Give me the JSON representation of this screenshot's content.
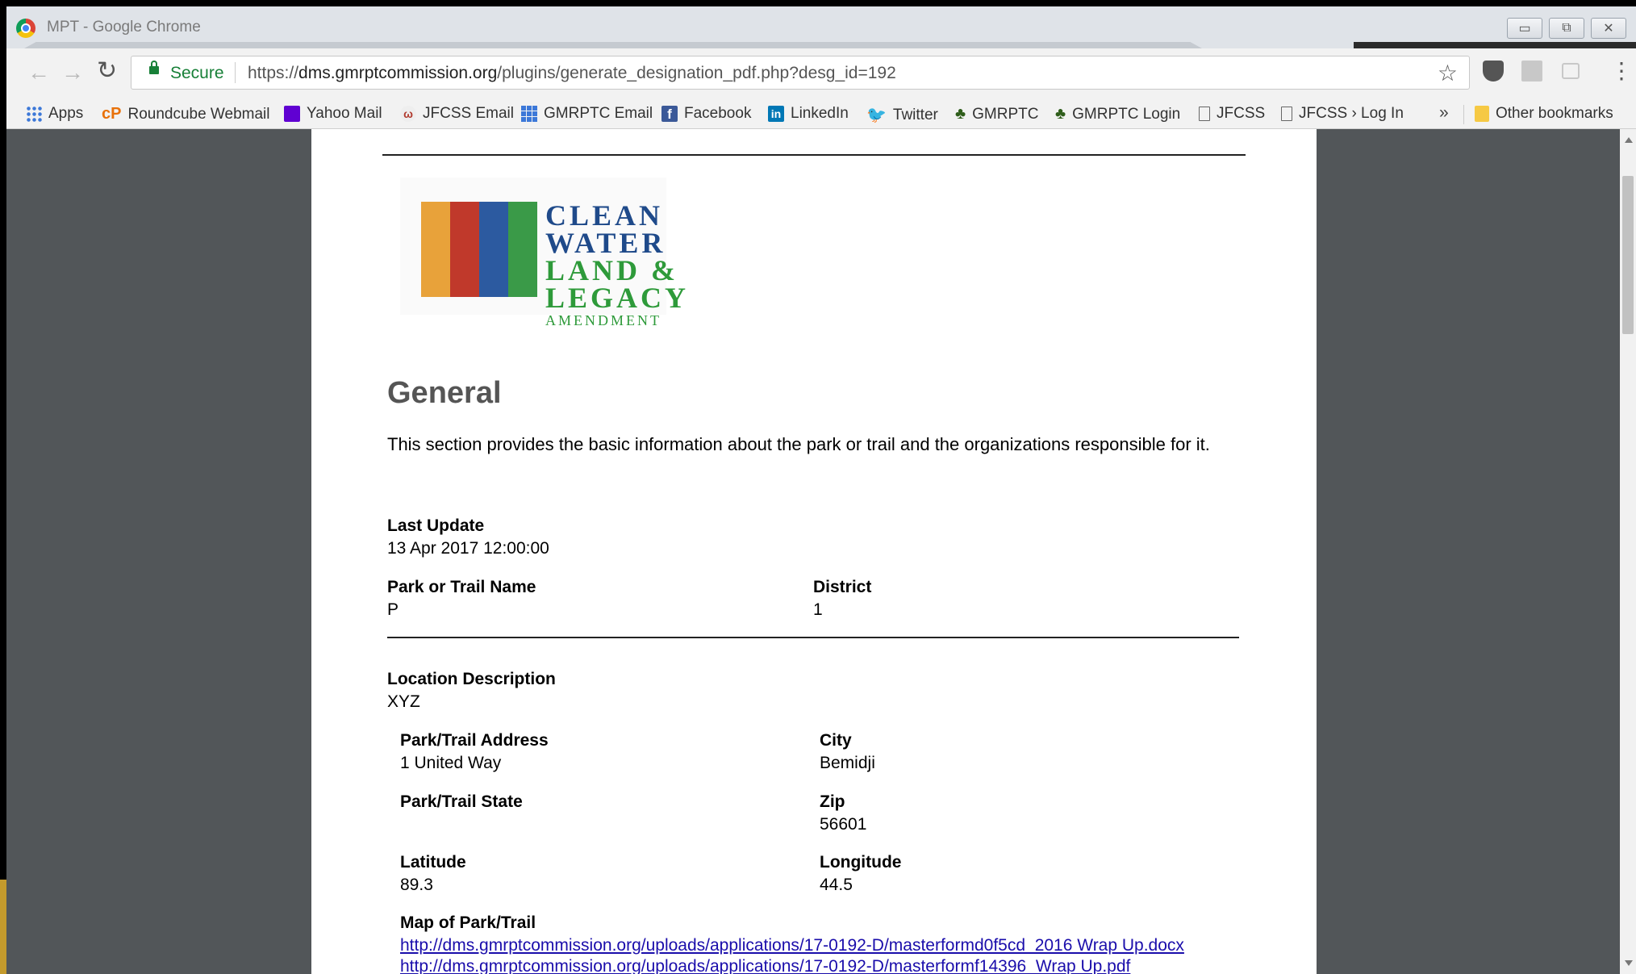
{
  "window": {
    "title": "MPT - Google Chrome"
  },
  "toolbar": {
    "secure_label": "Secure",
    "url_scheme": "https://",
    "url_host": "dms.gmrptcommission.org",
    "url_path": "/plugins/generate_designation_pdf.php?desg_id=192"
  },
  "bookmarks": {
    "items": [
      {
        "label": "Apps",
        "icon": "apps-grid-icon"
      },
      {
        "label": "Roundcube Webmail",
        "icon": "cpanel-icon"
      },
      {
        "label": "Yahoo Mail",
        "icon": "envelope-icon"
      },
      {
        "label": "JFCSS Email",
        "icon": "jfcss-icon"
      },
      {
        "label": "GMRPTC Email",
        "icon": "grid-icon"
      },
      {
        "label": "Facebook",
        "icon": "facebook-icon"
      },
      {
        "label": "LinkedIn",
        "icon": "linkedin-icon"
      },
      {
        "label": "Twitter",
        "icon": "twitter-icon"
      },
      {
        "label": "GMRPTC",
        "icon": "tree-icon"
      },
      {
        "label": "GMRPTC Login",
        "icon": "tree-icon"
      },
      {
        "label": "JFCSS",
        "icon": "page-icon"
      },
      {
        "label": "JFCSS › Log In",
        "icon": "page-icon"
      }
    ],
    "overflow": "»",
    "other": "Other bookmarks"
  },
  "logo": {
    "lines": [
      "CLEAN",
      "WATER",
      "LAND &",
      "LEGACY"
    ],
    "sub": "AMENDMENT"
  },
  "doc": {
    "heading": "General",
    "intro": "This section provides the basic information about the park or trail and the organizations responsible for it.",
    "last_update_label": "Last Update",
    "last_update_value": "13 Apr 2017 12:00:00",
    "park_name_label": "Park or Trail Name",
    "park_name_value": "P",
    "district_label": "District",
    "district_value": "1",
    "location_label": "Location Description",
    "location_value": "XYZ",
    "address_label": "Park/Trail Address",
    "address_value": "1 United Way",
    "city_label": "City",
    "city_value": "Bemidji",
    "state_label": "Park/Trail State",
    "state_value": "",
    "zip_label": "Zip",
    "zip_value": "56601",
    "latitude_label": "Latitude",
    "latitude_value": "89.3",
    "longitude_label": "Longitude",
    "longitude_value": "44.5",
    "map_label": "Map of Park/Trail",
    "map_links": [
      "http://dms.gmrptcommission.org/uploads/applications/17-0192-D/masterformd0f5cd_2016 Wrap Up.docx",
      "http://dms.gmrptcommission.org/uploads/applications/17-0192-D/masterformf14396_Wrap Up.pdf"
    ]
  }
}
